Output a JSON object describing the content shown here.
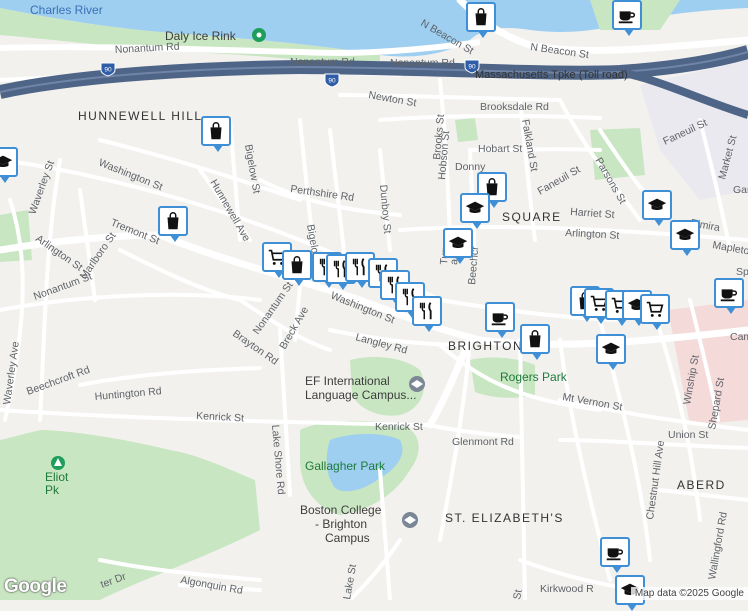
{
  "map": {
    "water": {
      "river": "Charles River",
      "pond_label": ""
    },
    "pois": {
      "rink": "Daly Ice Rink",
      "ef_line1": "EF International",
      "ef_line2": "Language Campus...",
      "park1": "Gallagher Park",
      "park2": "Rogers Park",
      "park3_line1": "Eliot",
      "park3_line2": "Pk",
      "bc_line1": "Boston College",
      "bc_line2": "- Brighton",
      "bc_line3": "Campus"
    },
    "areas": {
      "hunnewell": "HUNNEWELL HILL",
      "square": "SQUARE",
      "brighton": "BRIGHTON",
      "st_elizabeths": "ST. ELIZABETH'S",
      "aberdeen": "ABERD"
    },
    "highway": {
      "name": "Massachusetts Tpke (Toll road)",
      "shield": "90"
    },
    "streets": {
      "nonantum_rd": "Nonantum Rd",
      "n_beacon": "N Beacon St",
      "n_beacon_short": "N Beacon St",
      "newton": "Newton St",
      "brooksdale": "Brooksdale Rd",
      "brooks": "Brooks St",
      "falkland": "Falkland St",
      "faneuil": "Faneuil St",
      "faneuil2": "Faneuil St",
      "market": "Market St",
      "hobart": "Hobart St",
      "parsons": "Parsons St",
      "washington_w": "Washington St",
      "washington_c": "Washington St",
      "bigelow": "Bigelow St",
      "bigelow2": "Bigelow",
      "perthshire": "Perthshire Rd",
      "dunboy": "Dunboy St",
      "hobson": "Hobson St",
      "harriet": "Harriet St",
      "arlington": "Arlington St",
      "arlington_w": "Arlington St",
      "elmira": "Elmira",
      "mapleton": "Mapleton",
      "waverley": "Waverley St",
      "waverley_ave": "Waverley Ave",
      "tremont": "Tremont St",
      "marlboro": "Marlboro St",
      "nonantum_st": "Nonantum St",
      "nonantum_st2": "Nonantum St",
      "hunnewell_ave": "Hunnewell Ave",
      "breck": "Breck Ave",
      "brayton": "Brayton Rd",
      "langley": "Langley Rd",
      "beechcroft": "Beechcroft Rd",
      "huntington": "Huntington Rd",
      "kenrick": "Kenrick St",
      "kenrick2": "Kenrick St",
      "lake_shore": "Lake Shore Rd",
      "glenmont": "Glenmont Rd",
      "mt_vernon": "Mt Vernon St",
      "union": "Union St",
      "shepard": "Shepard St",
      "winship": "Winship St",
      "chestnut_hill": "Chestnut Hill Ave",
      "wallingford": "Wallingford Rd",
      "kirkwood": "Kirkwood R",
      "algonquin": "Algonquin Rd",
      "lake_st": "Lake St",
      "st_trunc": "St",
      "turner": "Turne",
      "banks": "anks St",
      "beechcroft2": "Beechcr",
      "sp": "Sp",
      "garr": "Garr",
      "cam": "Cam",
      "donny": "Donny",
      "ter_dr": "ter Dr"
    },
    "attribution": "Map data ©2025 Google",
    "logo": "Google"
  },
  "markers": [
    {
      "type": "shopping-bag",
      "name": "shop"
    },
    {
      "type": "coffee-cup",
      "name": "cafe"
    },
    {
      "type": "shopping-bag",
      "name": "shop"
    },
    {
      "type": "graduation-cap",
      "name": "school"
    },
    {
      "type": "shopping-bag",
      "name": "shop"
    },
    {
      "type": "shopping-cart",
      "name": "grocery"
    },
    {
      "type": "shopping-bag",
      "name": "shop"
    },
    {
      "type": "fork-knife",
      "name": "restaurant"
    },
    {
      "type": "fork-knife",
      "name": "restaurant"
    },
    {
      "type": "fork-knife",
      "name": "restaurant"
    },
    {
      "type": "fork-knife",
      "name": "restaurant"
    },
    {
      "type": "fork-knife",
      "name": "restaurant"
    },
    {
      "type": "fork-knife",
      "name": "restaurant"
    },
    {
      "type": "fork-knife",
      "name": "restaurant"
    },
    {
      "type": "shopping-bag",
      "name": "shop"
    },
    {
      "type": "shopping-bag",
      "name": "shop"
    },
    {
      "type": "graduation-cap",
      "name": "school"
    },
    {
      "type": "graduation-cap",
      "name": "school"
    },
    {
      "type": "graduation-cap",
      "name": "school"
    },
    {
      "type": "graduation-cap",
      "name": "school"
    },
    {
      "type": "coffee-cup",
      "name": "cafe"
    },
    {
      "type": "shopping-bag",
      "name": "shop"
    },
    {
      "type": "shopping-cart",
      "name": "grocery"
    },
    {
      "type": "shopping-cart",
      "name": "grocery"
    },
    {
      "type": "graduation-cap",
      "name": "school"
    },
    {
      "type": "shopping-cart",
      "name": "grocery"
    },
    {
      "type": "coffee-cup",
      "name": "cafe"
    },
    {
      "type": "graduation-cap",
      "name": "school"
    },
    {
      "type": "coffee-cup",
      "name": "cafe"
    },
    {
      "type": "graduation-cap",
      "name": "school"
    }
  ],
  "colors": {
    "water": "#9ecff0",
    "park": "#c9e6c2",
    "highway": "#4f6587",
    "pin": "#3f8fd6",
    "hospital": "#f5dada"
  }
}
